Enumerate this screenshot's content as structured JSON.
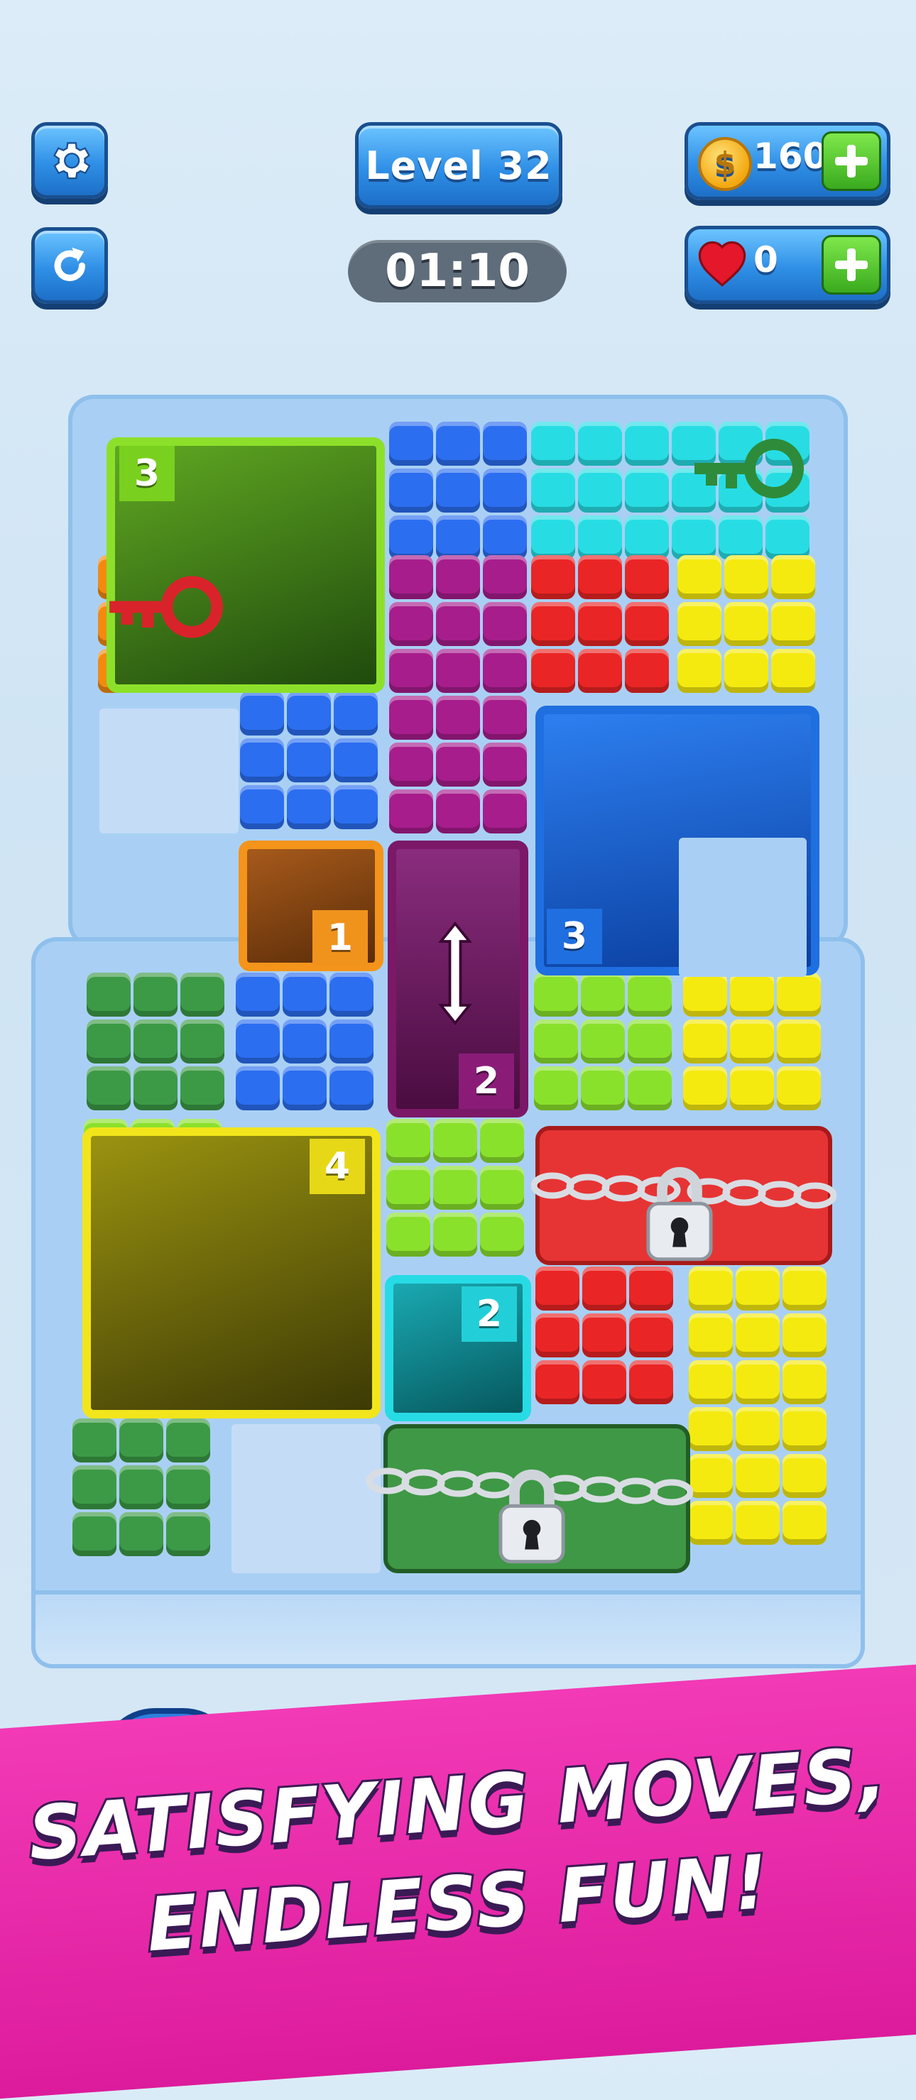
{
  "hud": {
    "level_label": "Level 32",
    "timer": "01:10",
    "coins": "160",
    "lives": "0"
  },
  "board": {
    "badges": {
      "green_hole": "3",
      "orange_hole": "1",
      "purple_hole": "2",
      "blue_hole": "3",
      "yellow_hole": "4",
      "teal_hole": "2"
    }
  },
  "slogan": {
    "line1": "SATISFYING MOVES,",
    "line2": "ENDLESS FUN!"
  },
  "colors": {
    "hud_blue": "#2f8fe6",
    "banner_pink": "#e92aa8",
    "board": "#a9d0f4"
  }
}
